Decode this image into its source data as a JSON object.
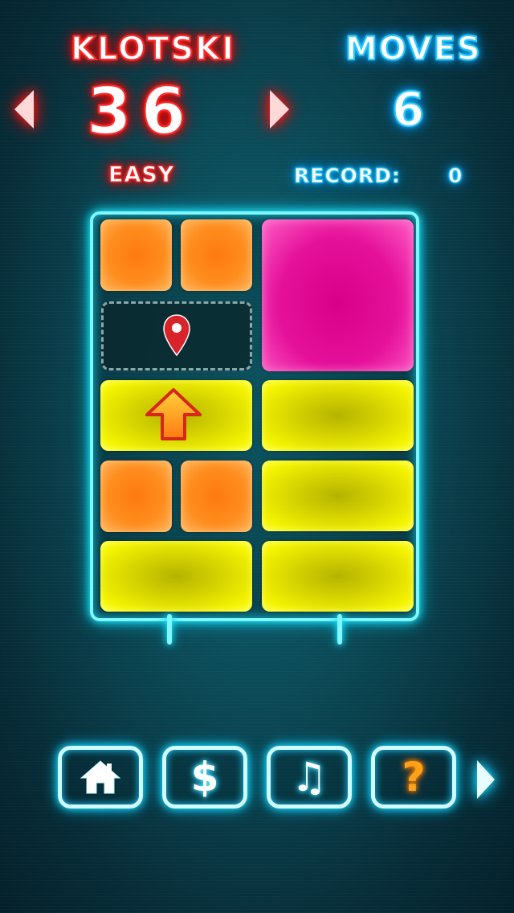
{
  "header": {
    "title": "KLOTSKI",
    "moves_label": "MOVES",
    "level_number": "36",
    "moves_value": "6",
    "difficulty": "EASY",
    "record_label": "RECORD:",
    "record_value": "0"
  },
  "board": {
    "columns": 4,
    "rows": 5,
    "tiles": [
      {
        "color": "orange",
        "size": "1x1"
      },
      {
        "color": "orange",
        "size": "1x1"
      },
      {
        "color": "pink",
        "size": "2x2"
      },
      {
        "color": "empty",
        "size": "2x1",
        "marker": "location-pin-icon"
      },
      {
        "color": "yellow",
        "size": "2x1",
        "hint": "up-arrow-icon"
      },
      {
        "color": "yellow",
        "size": "2x1"
      },
      {
        "color": "orange",
        "size": "1x1"
      },
      {
        "color": "orange",
        "size": "1x1"
      },
      {
        "color": "yellow",
        "size": "2x1"
      },
      {
        "color": "yellow",
        "size": "2x1"
      },
      {
        "color": "yellow",
        "size": "2x1"
      }
    ]
  },
  "toolbar": {
    "home_icon": "home-icon",
    "shop_label": "$",
    "music_label": "♫",
    "help_label": "?"
  },
  "colors": {
    "orange": "#ff8d1e",
    "pink": "#e5119a",
    "yellow": "#e8e600",
    "neon_red": "#ff2a2a",
    "neon_blue": "#2cc8ff",
    "neon_cyan": "#7ff7ff"
  }
}
